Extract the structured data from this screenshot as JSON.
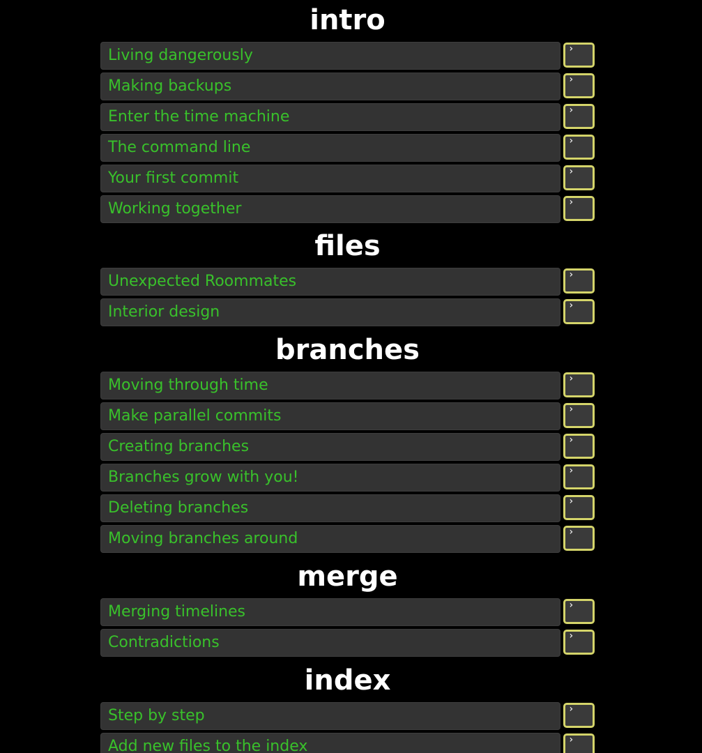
{
  "colors": {
    "background": "#000000",
    "title": "#ffffff",
    "level_text": "#39c12b",
    "level_bg": "#333333",
    "cli_border": "#d4d46a"
  },
  "sections": [
    {
      "title": "intro",
      "levels": [
        "Living dangerously",
        "Making backups",
        "Enter the time machine",
        "The command line",
        "Your first commit",
        "Working together"
      ]
    },
    {
      "title": "files",
      "levels": [
        "Unexpected Roommates",
        "Interior design"
      ]
    },
    {
      "title": "branches",
      "levels": [
        "Moving through time",
        "Make parallel commits",
        "Creating branches",
        "Branches grow with you!",
        "Deleting branches",
        "Moving branches around"
      ]
    },
    {
      "title": "merge",
      "levels": [
        "Merging timelines",
        "Contradictions"
      ]
    },
    {
      "title": "index",
      "levels": [
        "Step by step",
        "Add new files to the index"
      ]
    }
  ],
  "cli_icon": "terminal-prompt-icon",
  "cli_glyph": "›"
}
